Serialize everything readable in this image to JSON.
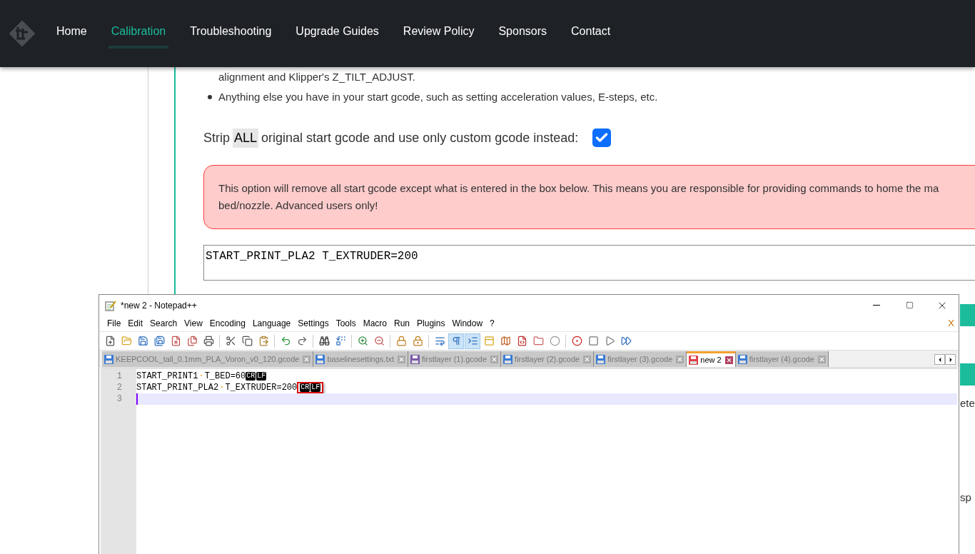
{
  "nav": {
    "items": [
      {
        "label": "Home",
        "selected": false
      },
      {
        "label": "Calibration",
        "selected": true
      },
      {
        "label": "Troubleshooting",
        "selected": false
      },
      {
        "label": "Upgrade Guides",
        "selected": false
      },
      {
        "label": "Review Policy",
        "selected": false
      },
      {
        "label": "Sponsors",
        "selected": false
      },
      {
        "label": "Contact",
        "selected": false
      }
    ]
  },
  "page": {
    "bullet_continuation": "alignment and Klipper's Z_TILT_ADJUST.",
    "bullets": [
      "Anything else you have in your start gcode, such as setting acceleration values, E-steps, etc."
    ],
    "strip_option": {
      "label_before": "Strip",
      "highlight": "ALL",
      "label_after": "original start gcode and use only custom gcode instead:",
      "checked": true
    },
    "warning": {
      "lines": [
        "This option will remove all start gcode except what is entered in the box below. This means you are responsible for providing commands to home the ma",
        "bed/nozzle. Advanced users only!"
      ]
    },
    "custom_gcode": {
      "value": "START_PRINT_PLA2 T_EXTRUDER=200"
    },
    "right_edge_fragments": [
      "ete",
      "sp"
    ]
  },
  "notepad": {
    "title": "*new 2 - Notepad++",
    "menu": [
      "File",
      "Edit",
      "Search",
      "View",
      "Encoding",
      "Language",
      "Settings",
      "Tools",
      "Macro",
      "Run",
      "Plugins",
      "Window",
      "?"
    ],
    "close_doc": "X",
    "toolbar": [
      {
        "active": false
      },
      {
        "active": false
      },
      {
        "active": false
      },
      {
        "active": false
      },
      {
        "active": false
      },
      {
        "active": false
      },
      {
        "active": false
      },
      {
        "active": false
      },
      {
        "active": false
      },
      {
        "active": false
      },
      {
        "active": false
      },
      {
        "active": false
      },
      {
        "active": false
      },
      {
        "active": false
      },
      {
        "active": false
      },
      {
        "active": false
      },
      {
        "active": false
      },
      {
        "active": false
      },
      {
        "active": false
      },
      {
        "active": true
      },
      {
        "active": true
      },
      {
        "active": false
      },
      {
        "active": false
      },
      {
        "active": false
      },
      {
        "active": false
      },
      {
        "active": false
      },
      {
        "active": false
      },
      {
        "active": false
      },
      {
        "active": false
      },
      {
        "active": false
      }
    ],
    "tabs": [
      {
        "label": "KEEPCOOL_tall_0.1mm_PLA_Voron_v0_120.gcode",
        "selected": false,
        "color": "#3a7bd5"
      },
      {
        "label": "baselinesettings.txt",
        "selected": false,
        "color": "#3a7bd5"
      },
      {
        "label": "firstlayer (1).gcode",
        "selected": false,
        "color": "#7a5aa8"
      },
      {
        "label": "firstlayer (2).gcode",
        "selected": false,
        "color": "#3a7bd5"
      },
      {
        "label": "firstlayer (3).gcode",
        "selected": false,
        "color": "#3a7bd5"
      },
      {
        "label": "new 2",
        "selected": true,
        "color": "#e0404a"
      },
      {
        "label": "firstlayer (4).gcode",
        "selected": false,
        "color": "#3a7bd5"
      }
    ],
    "lines": [
      {
        "number": "1",
        "segments": [
          "START_PRINT1",
          "T_BED=60"
        ],
        "space_mark": "·",
        "eol": [
          "CR",
          "LF"
        ],
        "marked": false,
        "current": false
      },
      {
        "number": "2",
        "segments": [
          "START_PRINT_PLA2",
          "T_EXTRUDER=200"
        ],
        "space_mark": "·",
        "eol": [
          "CR",
          "LF"
        ],
        "marked": true,
        "current": false
      },
      {
        "number": "3",
        "current": true
      }
    ]
  }
}
